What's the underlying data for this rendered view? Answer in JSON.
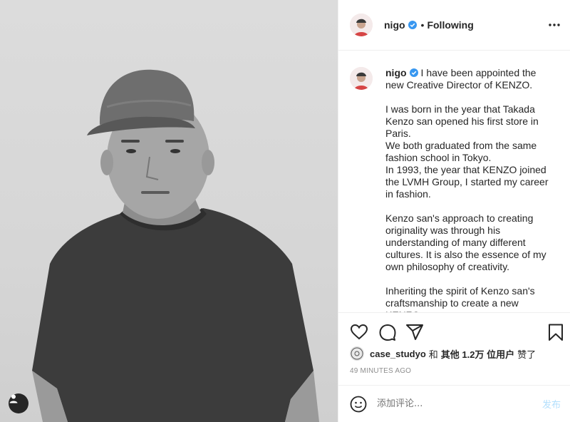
{
  "header": {
    "username": "nigo",
    "follow_status": "Following",
    "bullet": "•"
  },
  "caption": {
    "username": "nigo",
    "text": "I have been appointed the new Creative Director of KENZO.\n\nI was born in the year that Takada Kenzo san opened his first store in Paris.\nWe both graduated from the same fashion school in Tokyo.\nIn 1993, the year that KENZO joined the LVMH Group, I started my career in fashion.\n\nKenzo san's approach to creating originality was through his understanding of many different cultures. It is also the essence of my own philosophy of creativity.\n\nInheriting the spirit of Kenzo san's craftsmanship to create a new KENZO"
  },
  "likes": {
    "liker": "case_studyo",
    "and": "和",
    "others": "其他 1.2万 位用户",
    "liked": "赞了"
  },
  "timestamp": "49 MINUTES AGO",
  "comment": {
    "placeholder": "添加评论...",
    "post_label": "发布"
  },
  "colors": {
    "verified_badge": "#3897f0",
    "post_button_disabled": "#b2dffc",
    "secondary_text": "#8e8e8e",
    "divider": "#efefef"
  },
  "icons": [
    "verified-badge-icon",
    "more-options-icon",
    "heart-icon",
    "comment-icon",
    "share-icon",
    "bookmark-icon",
    "emoji-icon",
    "user-tag-icon"
  ]
}
